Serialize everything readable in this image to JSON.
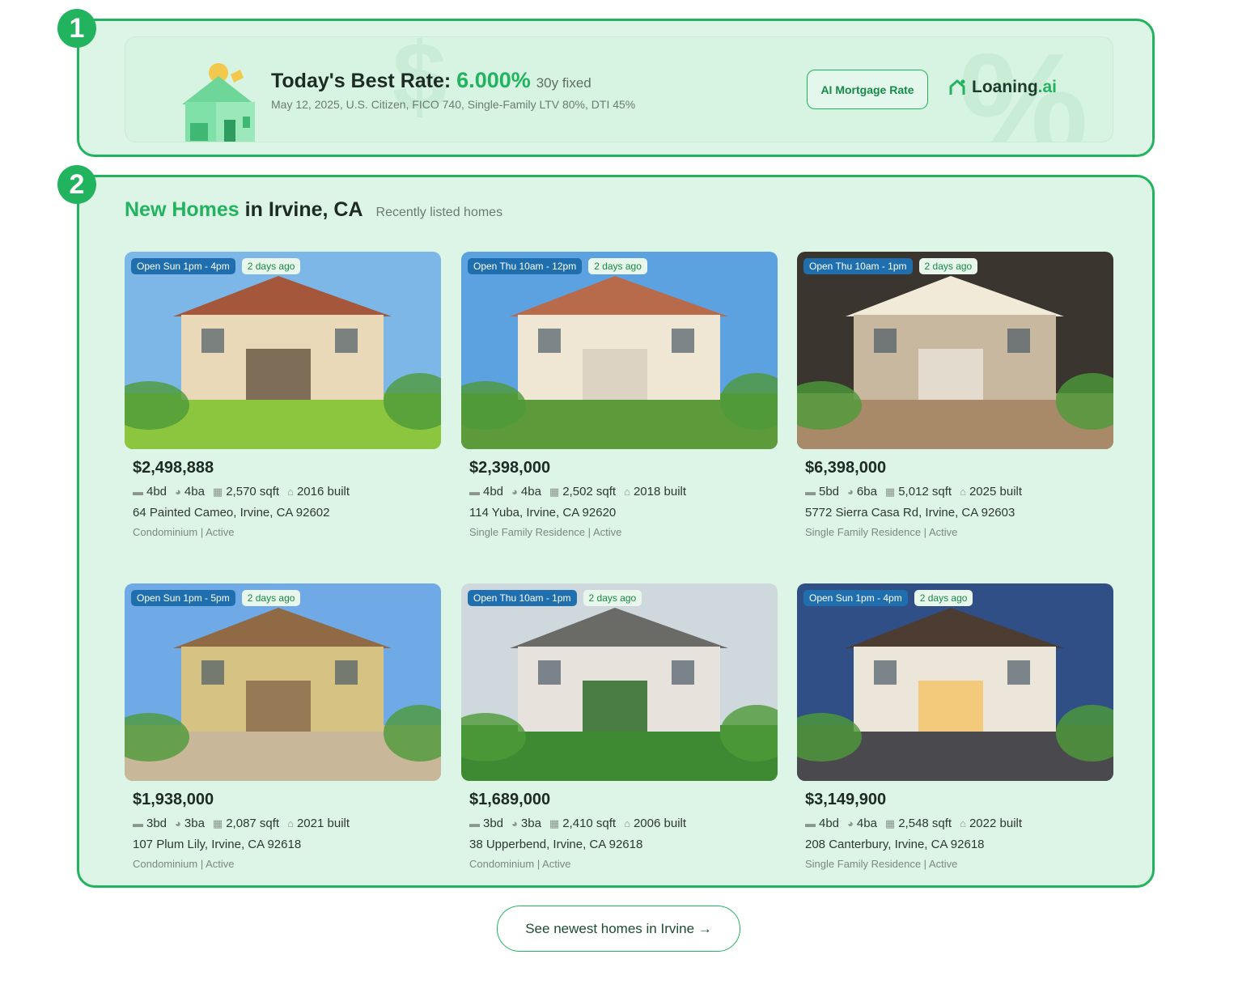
{
  "markers": [
    "1",
    "2"
  ],
  "rate_banner": {
    "title_prefix": "Today's Best Rate:",
    "rate": "6.000%",
    "term": "30y fixed",
    "subtitle": "May 12, 2025, U.S. Citizen, FICO 740, Single-Family LTV 80%, DTI 45%",
    "ai_button_label": "AI Mortgage Rate",
    "logo_name": "Loaning",
    "logo_suffix": ".ai"
  },
  "homes": {
    "title_highlight": "New Homes",
    "title_rest": "in Irvine, CA",
    "subtitle": "Recently listed homes",
    "listings": [
      {
        "open": "Open Sun 1pm - 4pm",
        "listed": "2 days ago",
        "price": "$2,498,888",
        "beds": "4bd",
        "baths": "4ba",
        "sqft": "2,570 sqft",
        "built": "2016 built",
        "address": "64 Painted Cameo, Irvine, CA 92602",
        "meta": "Condominium | Active",
        "photo": "house-garden"
      },
      {
        "open": "Open Thu 10am - 12pm",
        "listed": "2 days ago",
        "price": "$2,398,000",
        "beds": "4bd",
        "baths": "4ba",
        "sqft": "2,502 sqft",
        "built": "2018 built",
        "address": "114 Yuba, Irvine, CA 92620",
        "meta": "Single Family Residence | Active",
        "photo": "house-balcony"
      },
      {
        "open": "Open Thu 10am - 1pm",
        "listed": "2 days ago",
        "price": "$6,398,000",
        "beds": "5bd",
        "baths": "6ba",
        "sqft": "5,012 sqft",
        "built": "2025 built",
        "address": "5772 Sierra Casa Rd, Irvine, CA 92603",
        "meta": "Single Family Residence | Active",
        "photo": "interior"
      },
      {
        "open": "Open Sun 1pm - 5pm",
        "listed": "2 days ago",
        "price": "$1,938,000",
        "beds": "3bd",
        "baths": "3ba",
        "sqft": "2,087 sqft",
        "built": "2021 built",
        "address": "107 Plum Lily, Irvine, CA 92618",
        "meta": "Condominium | Active",
        "photo": "house-yellow"
      },
      {
        "open": "Open Thu 10am - 1pm",
        "listed": "2 days ago",
        "price": "$1,689,000",
        "beds": "3bd",
        "baths": "3ba",
        "sqft": "2,410 sqft",
        "built": "2006 built",
        "address": "38 Upperbend, Irvine, CA 92618",
        "meta": "Condominium | Active",
        "photo": "house-trees"
      },
      {
        "open": "Open Sun 1pm - 4pm",
        "listed": "2 days ago",
        "price": "$3,149,900",
        "beds": "4bd",
        "baths": "4ba",
        "sqft": "2,548 sqft",
        "built": "2022 built",
        "address": "208 Canterbury, Irvine, CA 92618",
        "meta": "Single Family Residence | Active",
        "photo": "house-dusk"
      }
    ]
  },
  "see_more_label": "See newest homes in Irvine →",
  "icons": {
    "beds": "bed-icon",
    "baths": "bath-icon",
    "sqft": "grid-icon",
    "built": "build-icon"
  },
  "colors": {
    "accent": "#22b35e",
    "open_badge": "#1f6fae",
    "section_bg": "#ddf5e7"
  }
}
